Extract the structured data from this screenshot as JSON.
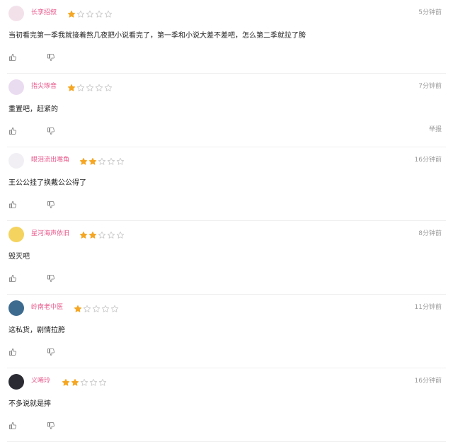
{
  "reviews": [
    {
      "username": "长孪招叙",
      "rating": 1,
      "time": "5分钟前",
      "text": "当初看完第一季我就接着熬几夜把小说看完了，第一季和小说大差不差吧，怎么第二季就拉了胯",
      "report": "",
      "avatar_color": "#f3e1ea"
    },
    {
      "username": "指尖琢音",
      "rating": 1,
      "time": "7分钟前",
      "text": "重置吧，赶紧的",
      "report": "举报",
      "avatar_color": "#e9dbf0"
    },
    {
      "username": "眼泪流出嘴角",
      "rating": 2,
      "time": "16分钟前",
      "text": "王公公挂了换戴公公得了",
      "report": "",
      "avatar_color": "#f1eef4"
    },
    {
      "username": "星河海声依旧",
      "rating": 2,
      "time": "8分钟前",
      "text": "毁灭吧",
      "report": "",
      "avatar_color": "#f4d35e"
    },
    {
      "username": "岭南老中医",
      "rating": 1,
      "time": "11分钟前",
      "text": "这私货，剧情拉胯",
      "report": "",
      "avatar_color": "#3d6b8f"
    },
    {
      "username": "义唏玲",
      "rating": 2,
      "time": "16分钟前",
      "text": "不多说就是摔",
      "report": "",
      "avatar_color": "#2b2b33"
    }
  ],
  "colors": {
    "star_on": "#f5a623",
    "star_off": "#c8c8c8",
    "username": "#e85a8c"
  },
  "icons": {
    "like": "thumb-up-icon",
    "dislike": "thumb-down-icon"
  }
}
